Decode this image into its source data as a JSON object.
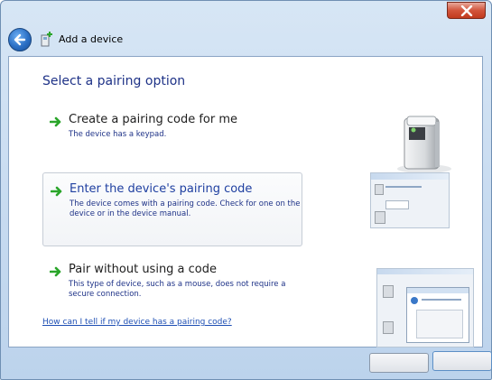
{
  "window": {
    "title": "Add a device"
  },
  "heading": "Select a pairing option",
  "options": [
    {
      "title": "Create a pairing code for me",
      "description": "The device has a keypad."
    },
    {
      "title": "Enter the device's pairing code",
      "description": "The device comes with a pairing code. Check for one on the device or in the device manual."
    },
    {
      "title": "Pair without using a code",
      "description": "This type of device, such as a mouse, does not require a secure connection."
    }
  ],
  "help_link": "How can I tell if my device has a pairing code?",
  "colors": {
    "accent": "#1e3287",
    "link": "#1e4fb4",
    "arrow": "#2aa52a",
    "close": "#c13a1e"
  },
  "icons": [
    "back-arrow-icon",
    "add-device-icon",
    "green-arrow-icon",
    "close-icon",
    "device-icon"
  ]
}
